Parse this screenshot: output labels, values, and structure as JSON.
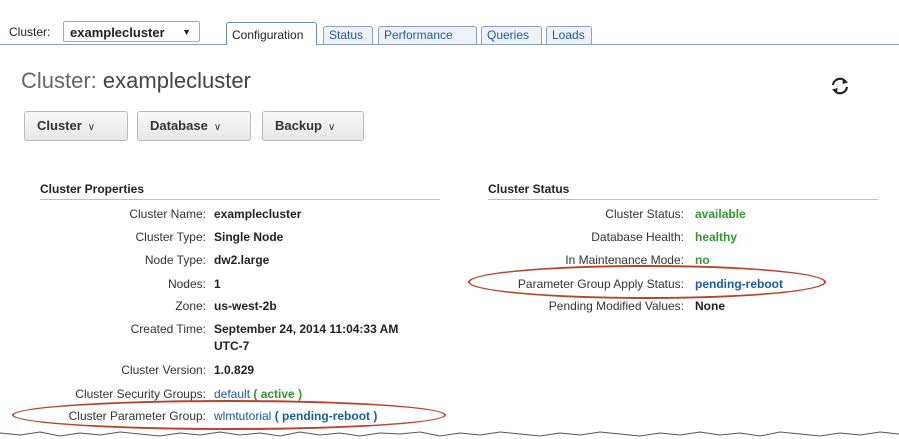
{
  "topbar": {
    "cluster_label": "Cluster:",
    "cluster_selected": "examplecluster",
    "tabs": [
      {
        "label": "Configuration",
        "active": true
      },
      {
        "label": "Status",
        "active": false
      },
      {
        "label": "Performance",
        "active": false
      },
      {
        "label": "Queries",
        "active": false
      },
      {
        "label": "Loads",
        "active": false
      }
    ]
  },
  "header": {
    "title_prefix": "Cluster:",
    "title_name": "examplecluster",
    "refresh_icon": "refresh-icon"
  },
  "actions": {
    "cluster": "Cluster",
    "database": "Database",
    "backup": "Backup"
  },
  "properties": {
    "heading": "Cluster Properties",
    "rows": [
      {
        "label": "Cluster Name:",
        "value": "examplecluster"
      },
      {
        "label": "Cluster Type:",
        "value": "Single Node"
      },
      {
        "label": "Node Type:",
        "value": "dw2.large"
      },
      {
        "label": "Nodes:",
        "value": "1"
      },
      {
        "label": "Zone:",
        "value": "us-west-2b"
      },
      {
        "label": "Created Time:",
        "value_line1": "September 24, 2014 11:04:33 AM",
        "value_line2": "UTC-7"
      },
      {
        "label": "Cluster Version:",
        "value": "1.0.829"
      },
      {
        "label": "Cluster Security Groups:",
        "link": "default",
        "status": "( active )"
      },
      {
        "label": "Cluster Parameter Group:",
        "link": "wlmtutorial",
        "status": "( pending-reboot )"
      }
    ]
  },
  "status": {
    "heading": "Cluster Status",
    "rows": [
      {
        "label": "Cluster Status:",
        "value": "available",
        "color": "#2e9a2e"
      },
      {
        "label": "Database Health:",
        "value": "healthy",
        "color": "#2e9a2e"
      },
      {
        "label": "In Maintenance Mode:",
        "value": "no",
        "color": "#2e9a2e"
      },
      {
        "label": "Parameter Group Apply Status:",
        "value": "pending-reboot",
        "color": "#1a5ba8"
      },
      {
        "label": "Pending Modified Values:",
        "value": "None",
        "color": "#222222"
      }
    ]
  },
  "colors": {
    "accent": "#1a5ba8",
    "ok": "#2e9a2e",
    "highlight": "#b8432a"
  }
}
